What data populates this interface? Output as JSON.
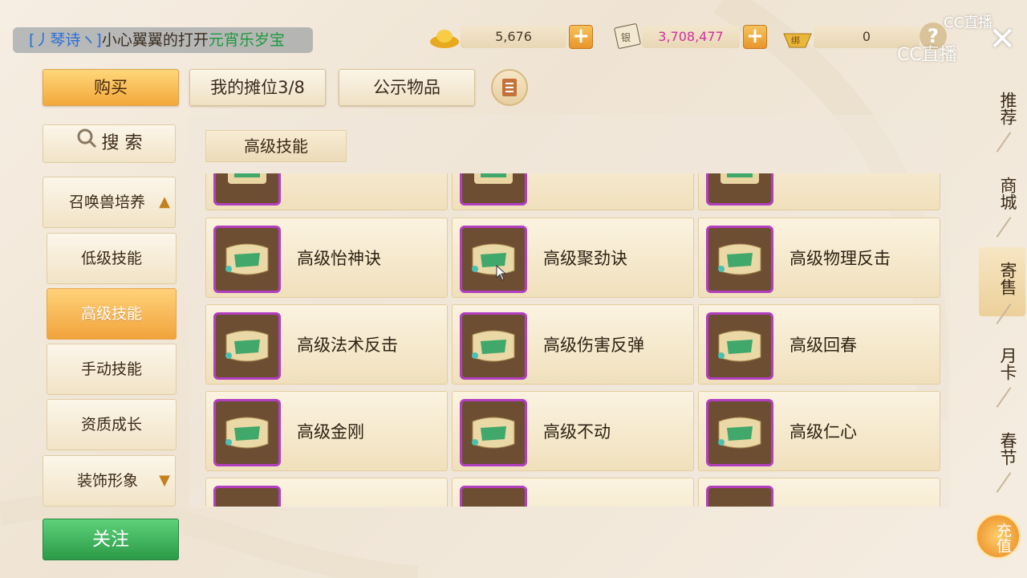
{
  "chat": {
    "part1": "[丿琴诗ヽ]",
    "part2": "小心翼翼的打开",
    "part3": "元宵乐岁宝"
  },
  "currency": {
    "gold": {
      "value": "5,676",
      "icon": "gold-ingot-icon"
    },
    "silver": {
      "value": "3,708,477",
      "icon": "silver-note-icon"
    },
    "bind": {
      "value": "0",
      "icon": "bound-ingot-icon"
    }
  },
  "watermark": "CC直播",
  "tabs": [
    {
      "label": "购买"
    },
    {
      "label": "我的摊位3/8"
    },
    {
      "label": "公示物品"
    }
  ],
  "search": {
    "label": "搜 索"
  },
  "current_category": "高级技能",
  "category_group": {
    "label": "召唤兽培养"
  },
  "sidebar": [
    {
      "label": "低级技能"
    },
    {
      "label": "高级技能"
    },
    {
      "label": "手动技能"
    },
    {
      "label": "资质成长"
    },
    {
      "label": "装饰形象"
    }
  ],
  "follow": {
    "label": "关注"
  },
  "items": [
    {
      "name": "高级怡神诀"
    },
    {
      "name": "高级聚劲诀"
    },
    {
      "name": "高级物理反击"
    },
    {
      "name": "高级法术反击"
    },
    {
      "name": "高级伤害反弹"
    },
    {
      "name": "高级回春"
    },
    {
      "name": "高级金刚"
    },
    {
      "name": "高级不动"
    },
    {
      "name": "高级仁心"
    }
  ],
  "right_nav": [
    {
      "label": "推荐"
    },
    {
      "label": "商城"
    },
    {
      "label": "寄售"
    },
    {
      "label": "月卡"
    },
    {
      "label": "春节"
    }
  ],
  "recharge": {
    "label": "充值"
  },
  "colors": {
    "accent": "#f3a83a",
    "follow": "#2c9a48",
    "icon_border": "#b23fc0"
  }
}
